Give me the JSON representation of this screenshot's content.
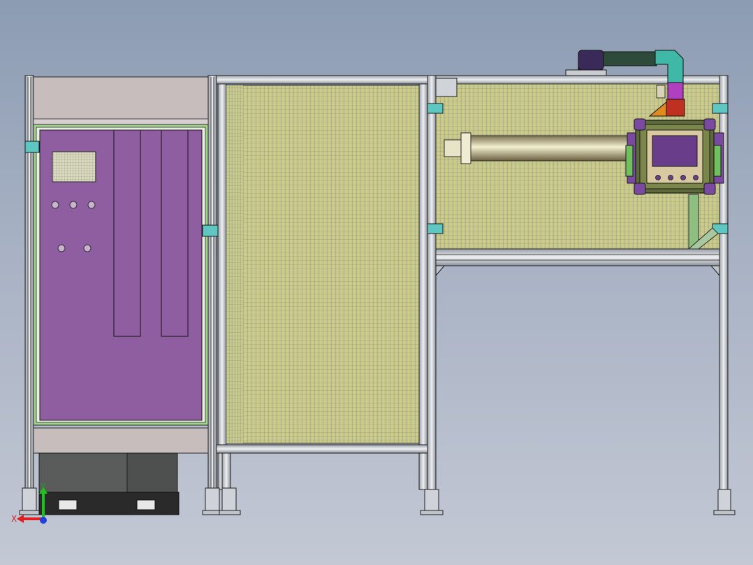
{
  "viewport": {
    "background_top": "#8c9cb3",
    "background_bottom": "#c3c8d4"
  },
  "triad": {
    "x_label": "X",
    "y_label": "Y",
    "x_color": "#e02020",
    "y_color": "#20c020",
    "z_color": "#2040e0"
  },
  "colors": {
    "frame_profile": "#cfd3d9",
    "frame_dark": "#2b2b2b",
    "cabinet_door": "#8e5ea0",
    "cabinet_panel": "#c8bdbd",
    "green_trim": "#9fd48a",
    "mesh_fill": "#c9c88a",
    "teal_bracket": "#5fc7c2",
    "hmi_body": "#6f7a45",
    "hmi_screen": "#6a3d8a",
    "magenta_part": "#b040c0",
    "orange_part": "#e08a20",
    "red_part": "#c03020",
    "base_dark": "#2a2a2a",
    "base_grey": "#5a5c5c"
  },
  "components": {
    "cabinet": "electrical-cabinet",
    "mesh_panel": "safety-mesh-panel",
    "robot_cell": "robot-cell-frame",
    "hmi": "operator-hmi-panel"
  }
}
